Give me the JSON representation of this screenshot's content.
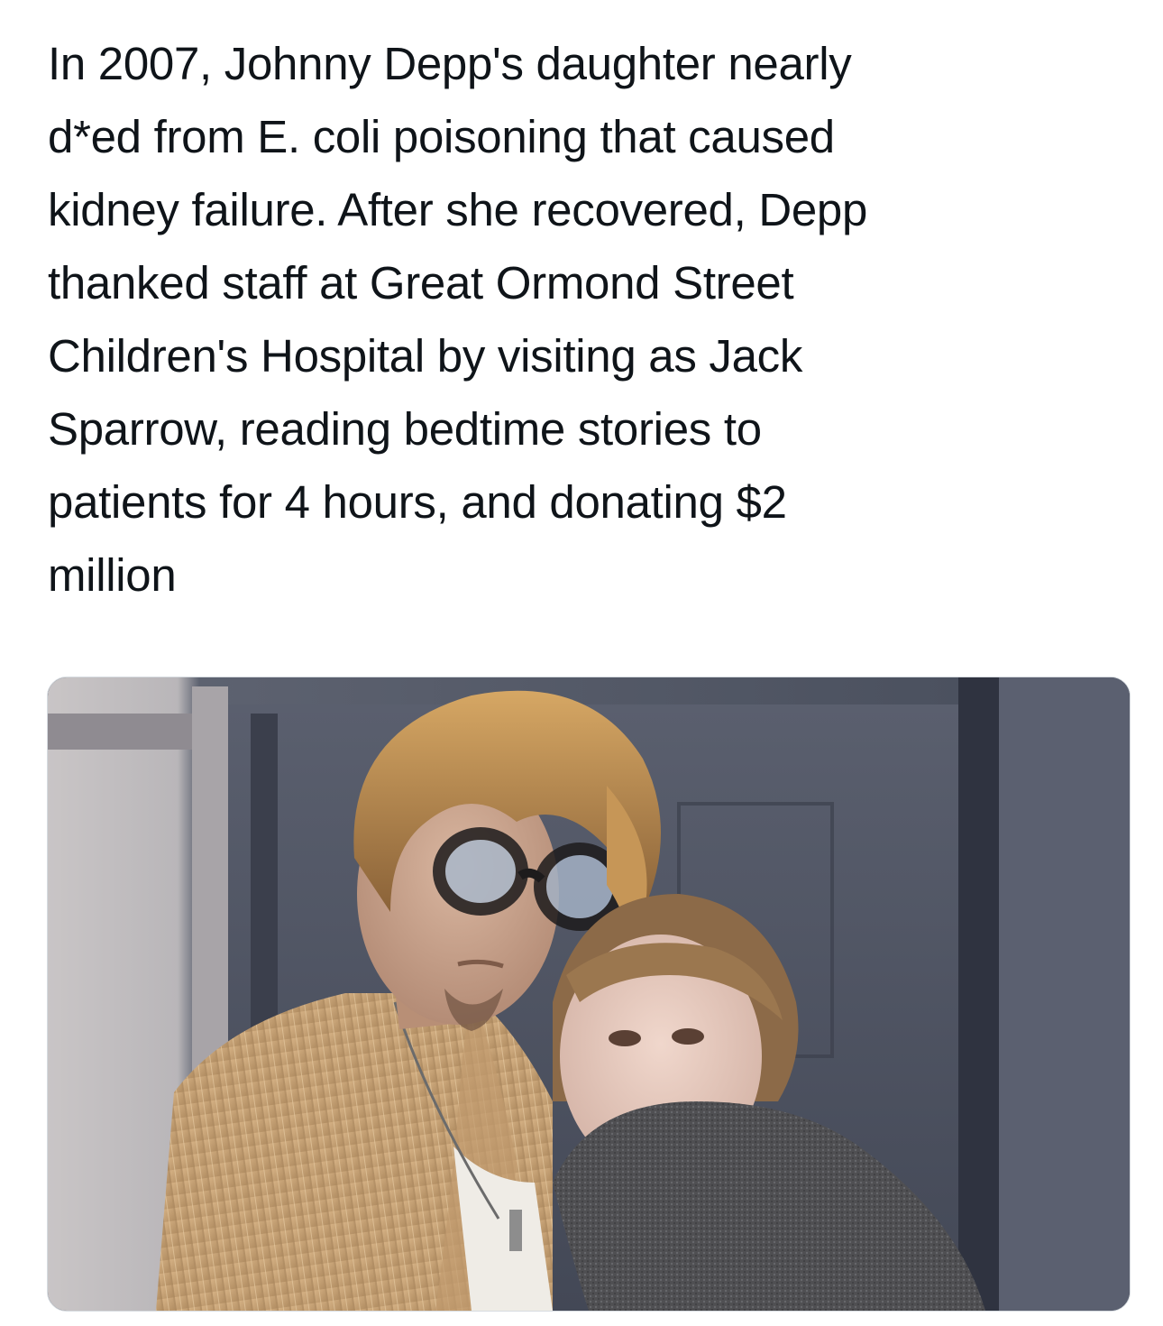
{
  "post": {
    "text": "In 2007, Johnny Depp's daughter nearly\nd*ed from E. coli poisoning that caused\nkidney failure. After she recovered, Depp\nthanked staff at Great Ormond Street\nChildren's Hospital by visiting as Jack\nSparrow, reading bedtime stories to\npatients for 4 hours, and donating $2\nmillion"
  },
  "colors": {
    "background": "#ffffff",
    "text": "#0f1419",
    "media_border": "#d6dbe0"
  }
}
